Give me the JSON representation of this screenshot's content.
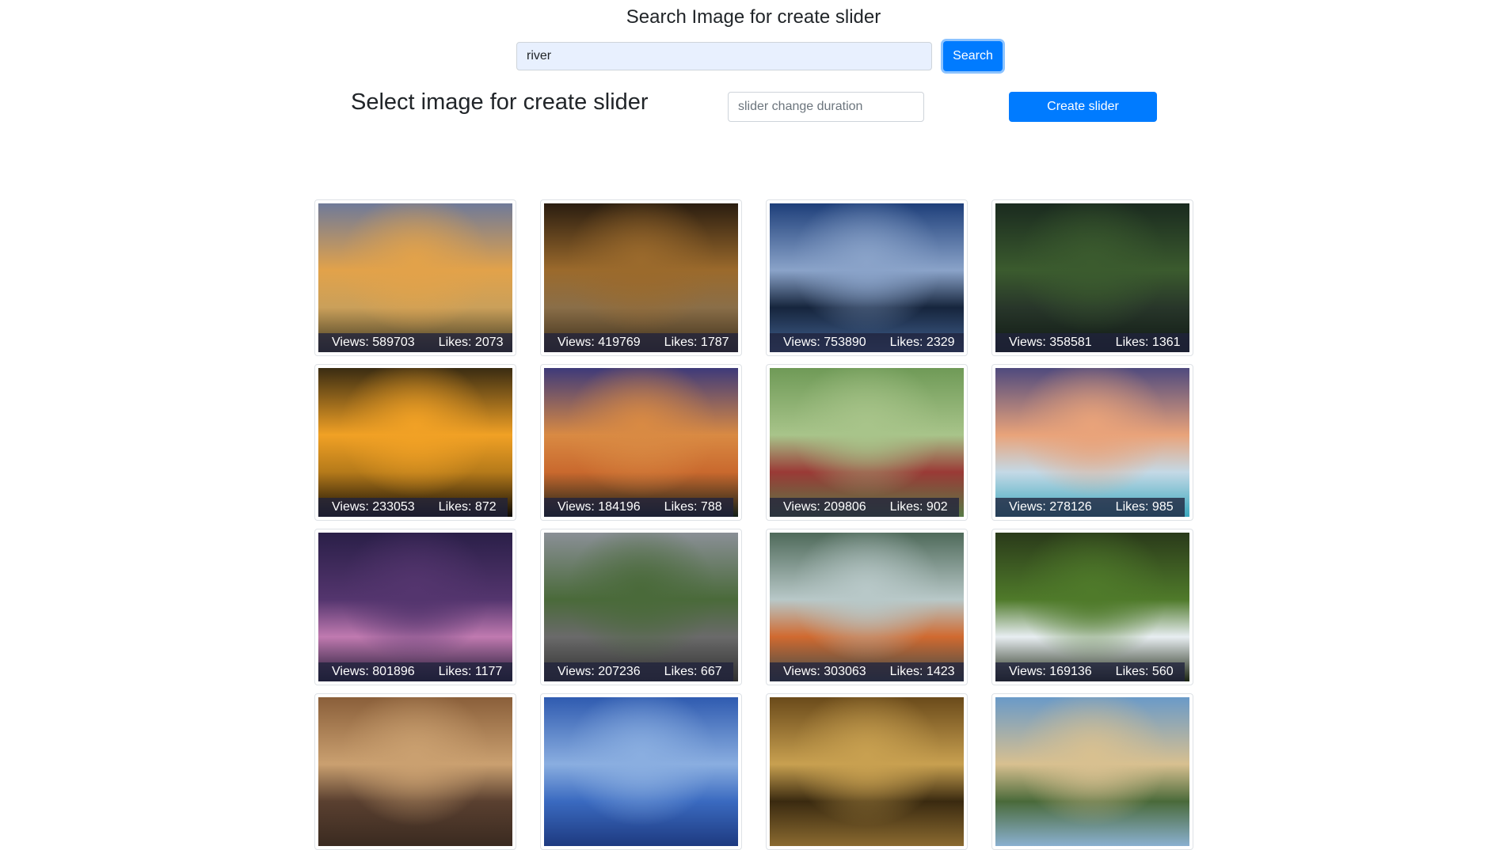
{
  "search": {
    "title": "Search Image for create slider",
    "value": "river",
    "button_label": "Search"
  },
  "slider": {
    "title": "Select image for create slider",
    "duration_placeholder": "slider change duration",
    "create_label": "Create slider"
  },
  "images": [
    {
      "views": "Views: 589703",
      "likes": "Likes: 2073",
      "colors": [
        "#6f7a99",
        "#e2a24a",
        "#caa05a",
        "#3a3520"
      ]
    },
    {
      "views": "Views: 419769",
      "likes": "Likes: 1787",
      "colors": [
        "#2a1d10",
        "#9b6a2c",
        "#8a6e48",
        "#3a2c18"
      ]
    },
    {
      "views": "Views: 753890",
      "likes": "Likes: 2329",
      "colors": [
        "#1e3f7a",
        "#8aa3c9",
        "#16253d",
        "#42618f"
      ]
    },
    {
      "views": "Views: 358581",
      "likes": "Likes: 1361",
      "colors": [
        "#1a2a1f",
        "#3b5b2e",
        "#28362a",
        "#0f1a14"
      ]
    },
    {
      "views": "Views: 233053",
      "likes": "Likes: 872",
      "colors": [
        "#3a2c12",
        "#f1a125",
        "#b57a1a",
        "#0c0a06"
      ]
    },
    {
      "views": "Views: 184196",
      "likes": "Likes: 788",
      "colors": [
        "#3e3a7a",
        "#d98a43",
        "#c9692e",
        "#122018"
      ]
    },
    {
      "views": "Views: 209806",
      "likes": "Likes: 902",
      "colors": [
        "#6f9a57",
        "#a8c48a",
        "#9a3a36",
        "#577a46"
      ]
    },
    {
      "views": "Views: 278126",
      "likes": "Likes: 985",
      "colors": [
        "#4f4a7e",
        "#e9a37a",
        "#c4d9e6",
        "#3aa8be"
      ]
    },
    {
      "views": "Views: 801896",
      "likes": "Likes: 1177",
      "colors": [
        "#2a1f48",
        "#54356e",
        "#c07ab0",
        "#1a1630"
      ]
    },
    {
      "views": "Views: 207236",
      "likes": "Likes: 667",
      "colors": [
        "#8a8f96",
        "#4a6a3a",
        "#6a6a6a",
        "#2f2f2f"
      ]
    },
    {
      "views": "Views: 303063",
      "likes": "Likes: 1423",
      "colors": [
        "#4f6a5a",
        "#b8c8c8",
        "#d06a30",
        "#3a4a4a"
      ]
    },
    {
      "views": "Views: 169136",
      "likes": "Likes: 560",
      "colors": [
        "#2a3a1a",
        "#4f7a2a",
        "#e8eef2",
        "#1a2410"
      ]
    },
    {
      "views": "",
      "likes": "",
      "colors": [
        "#8a5f3a",
        "#caa070",
        "#5a4030",
        "#3a2a20"
      ]
    },
    {
      "views": "",
      "likes": "",
      "colors": [
        "#2f5bb0",
        "#8aaee0",
        "#3a6ac0",
        "#1e3a80"
      ]
    },
    {
      "views": "",
      "likes": "",
      "colors": [
        "#6a4a1a",
        "#c8a050",
        "#3a2a10",
        "#8a6a30"
      ]
    },
    {
      "views": "",
      "likes": "",
      "colors": [
        "#6a9ac8",
        "#d8c090",
        "#4a6a3a",
        "#8ab0d0"
      ]
    }
  ]
}
